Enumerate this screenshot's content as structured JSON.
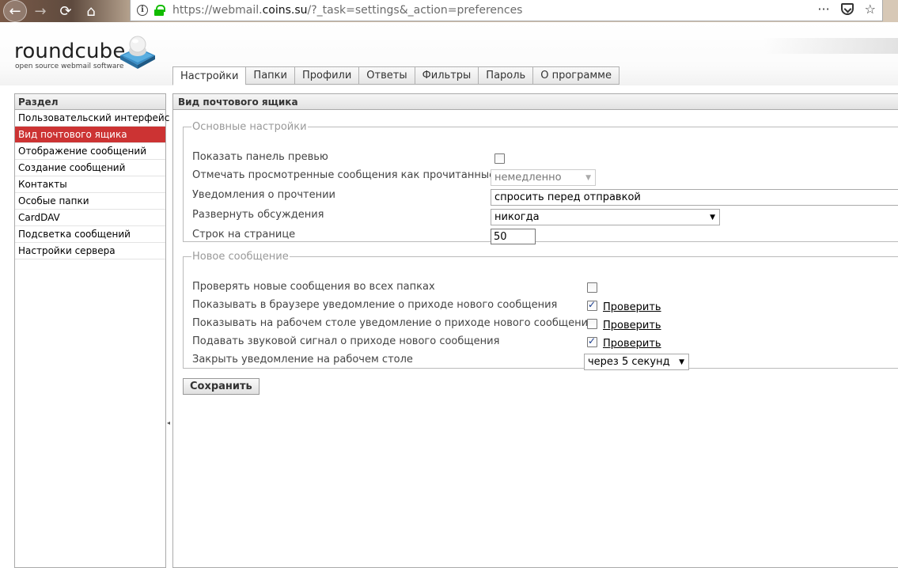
{
  "browser": {
    "url_prefix": "https://webmail.",
    "url_host": "coins.su",
    "url_path": "/?_task=settings&_action=preferences",
    "back_icon": "←",
    "forward_icon": "→",
    "reload_icon": "⟳",
    "home_icon": "⌂",
    "more_icon": "···",
    "star_icon": "☆"
  },
  "logo": {
    "name": "roundcube",
    "tagline": "open source webmail software"
  },
  "tabs": [
    {
      "label": "Настройки"
    },
    {
      "label": "Папки"
    },
    {
      "label": "Профили"
    },
    {
      "label": "Ответы"
    },
    {
      "label": "Фильтры"
    },
    {
      "label": "Пароль"
    },
    {
      "label": "О программе"
    }
  ],
  "sidebar": {
    "title": "Раздел",
    "items": [
      {
        "label": "Пользовательский интерфейс"
      },
      {
        "label": "Вид почтового ящика"
      },
      {
        "label": "Отображение сообщений"
      },
      {
        "label": "Создание сообщений"
      },
      {
        "label": "Контакты"
      },
      {
        "label": "Особые папки"
      },
      {
        "label": "CardDAV"
      },
      {
        "label": "Подсветка сообщений"
      },
      {
        "label": "Настройки сервера"
      }
    ]
  },
  "main": {
    "title": "Вид почтового ящика",
    "basic": {
      "legend": "Основные настройки",
      "preview_label": "Показать панель превью",
      "mark_read_label": "Отмечать просмотренные сообщения как прочитанные",
      "mark_read_value": "немедленно",
      "receipts_label": "Уведомления о прочтении",
      "receipts_value": "спросить перед отправкой",
      "threads_label": "Развернуть обсуждения",
      "threads_value": "никогда",
      "rows_label": "Строк на странице",
      "rows_value": "50"
    },
    "new_message": {
      "legend": "Новое сообщение",
      "check_all_label": "Проверять новые сообщения во всех папках",
      "browser_notify_label": "Показывать в браузере уведомление о приходе нового сообщения",
      "desktop_notify_label": "Показывать на рабочем столе уведомление о приходе нового сообщения",
      "sound_label": "Подавать звуковой сигнал о приходе нового сообщения",
      "close_notify_label": "Закрыть уведомление на рабочем столе",
      "close_notify_value": "через 5 секунд",
      "test_link": "Проверить"
    },
    "save_label": "Сохранить"
  },
  "colors": {
    "selected_item": "#cc3333",
    "checkmark": "#1a3d8f",
    "lock": "#12bc00"
  }
}
